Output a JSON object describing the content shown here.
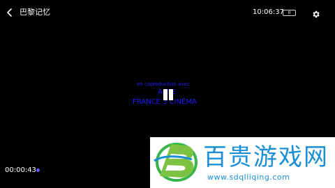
{
  "header": {
    "back_icon": "chevron-left-icon",
    "title": "巴黎记忆",
    "clock": "10:06:37",
    "battery_icon": "battery-icon",
    "battery_level": "0",
    "settings_icon": "gear-icon"
  },
  "video": {
    "credits": {
      "line1": "en coproduction avec",
      "line2": "ARTE",
      "line3": "FRANCE 3 CINÉMA"
    },
    "credits_color": "#1f1fff",
    "pause_icon": "pause-icon"
  },
  "playback": {
    "elapsed": "00:00:43",
    "accent_color": "#5a5cff"
  },
  "watermark": {
    "name": "百贵游戏网",
    "url": "www.sdqlliqing.com",
    "color": "#1a8fd8"
  }
}
